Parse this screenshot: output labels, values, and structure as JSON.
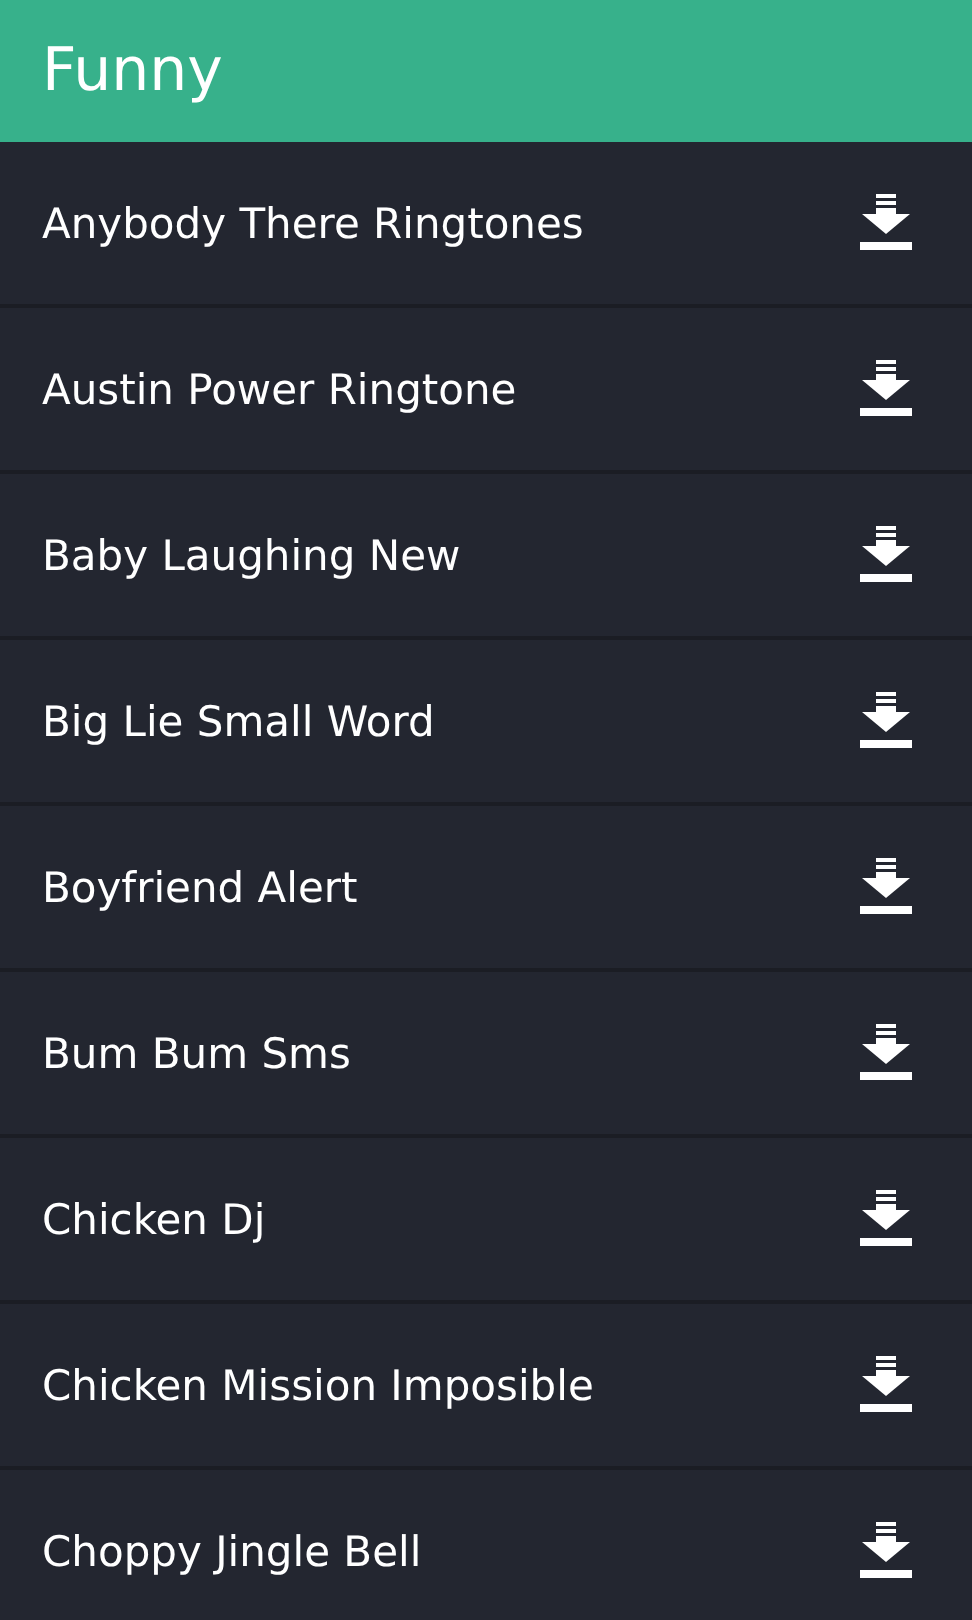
{
  "header": {
    "title": "Funny"
  },
  "items": [
    {
      "title": "Anybody There Ringtones"
    },
    {
      "title": "Austin Power Ringtone"
    },
    {
      "title": "Baby Laughing New"
    },
    {
      "title": "Big Lie Small Word"
    },
    {
      "title": "Boyfriend Alert"
    },
    {
      "title": "Bum Bum Sms"
    },
    {
      "title": "Chicken Dj"
    },
    {
      "title": "Chicken Mission Imposible"
    },
    {
      "title": "Choppy Jingle Bell"
    }
  ]
}
